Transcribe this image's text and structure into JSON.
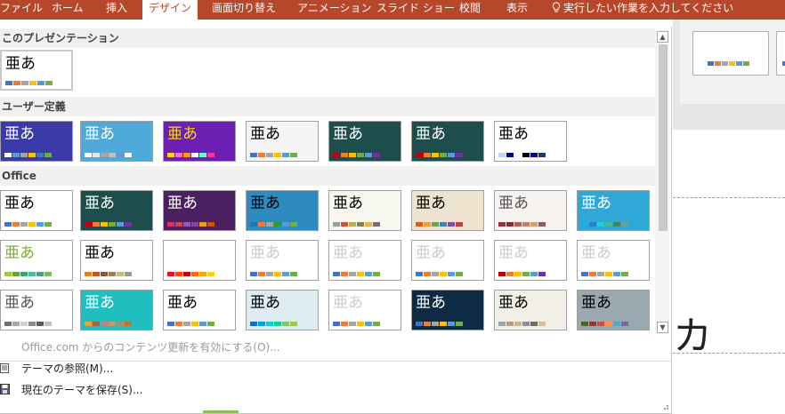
{
  "ribbon": {
    "tabs": [
      {
        "label": "ファイル",
        "active": false
      },
      {
        "label": "ホーム",
        "active": false
      },
      {
        "label": "挿入",
        "active": false
      },
      {
        "label": "デザイン",
        "active": true
      },
      {
        "label": "画面切り替え",
        "active": false
      },
      {
        "label": "アニメーション",
        "active": false
      },
      {
        "label": "スライド ショー",
        "active": false
      },
      {
        "label": "校閲",
        "active": false
      },
      {
        "label": "表示",
        "active": false
      }
    ],
    "tell_me": "実行したい作業を入力してください",
    "tell_me_icon": "lightbulb-icon",
    "accent_color": "#b7472a"
  },
  "background": {
    "slide_glyph": "カ"
  },
  "gallery": {
    "sections": [
      {
        "title": "このプレゼンテーション"
      },
      {
        "title": "ユーザー定義"
      },
      {
        "title": "Office"
      }
    ],
    "theme_sample_text": "亜あ",
    "this_presentation": [
      {
        "colors": [
          "#4472c4",
          "#ed7d31",
          "#a5a5a5",
          "#ffc000",
          "#5b9bd5",
          "#70ad47"
        ]
      }
    ],
    "custom": [
      {
        "bg": "#3a3aa8",
        "fg": "#ffffff",
        "colors": [
          "#ffffff",
          "#5b9bd5",
          "#a5a5a5",
          "#ffc000",
          "#4472c4",
          "#70ad47"
        ]
      },
      {
        "bg": "#4fa9d9",
        "fg": "#ffffff",
        "colors": [
          "#ffffff",
          "#d9e8f5",
          "#a5a5a5",
          "#bfbfbf",
          "#5b9bd5",
          "#ffffff"
        ]
      },
      {
        "bg": "#6b1fb3",
        "fg": "#ffd700",
        "colors": [
          "#ffd700",
          "#ff66cc",
          "#ff9900",
          "#ffffff",
          "#66ffcc",
          "#ff3399"
        ]
      },
      {
        "bg": "#f4f4f4",
        "fg": "#000000",
        "colors": [
          "#4472c4",
          "#ed7d31",
          "#a5a5a5",
          "#ffc000",
          "#5b9bd5",
          "#70ad47"
        ]
      },
      {
        "bg": "#1e4d4d",
        "fg": "#ffffff",
        "colors": [
          "#c00000",
          "#ed7d31",
          "#ffc000",
          "#70ad47",
          "#5b9bd5",
          "#7030a0"
        ]
      },
      {
        "bg": "#1e4d4d",
        "fg": "#ffffff",
        "colors": [
          "#c00000",
          "#ed7d31",
          "#ffc000",
          "#70ad47",
          "#5b9bd5",
          "#7030a0"
        ]
      },
      {
        "bg": "#ffffff",
        "fg": "#000000",
        "colors": [
          "#bdd7ee",
          "#000080",
          "#ffffff",
          "#000000",
          "#000080",
          "#1f3864"
        ]
      }
    ],
    "office": [
      {
        "bg": "#ffffff",
        "fg": "#000000",
        "colors": [
          "#4472c4",
          "#ed7d31",
          "#a5a5a5",
          "#ffc000",
          "#5b9bd5",
          "#70ad47"
        ]
      },
      {
        "bg": "#1e4d4d",
        "fg": "#ffffff",
        "colors": [
          "#c00000",
          "#ed7d31",
          "#ffc000",
          "#70ad47",
          "#5b9bd5",
          "#7030a0"
        ]
      },
      {
        "bg": "#4a2060",
        "fg": "#ffffff",
        "colors": [
          "#e03070",
          "#c0504d",
          "#9b59b6",
          "#8e44ad",
          "#f39c12",
          "#d35400"
        ]
      },
      {
        "bg": "#2e8bc0",
        "fg": "#000000",
        "colors": [
          "#1f78b4",
          "#ed7d31",
          "#a5a5a5",
          "#2ca02c",
          "#5b9bd5",
          "#70ad47"
        ]
      },
      {
        "bg": "#f7f7ef",
        "fg": "#000000",
        "colors": [
          "#93a299",
          "#cf543f",
          "#b5ae53",
          "#848058",
          "#e8b54d",
          "#786c71"
        ]
      },
      {
        "bg": "#ede3cf",
        "fg": "#000000",
        "colors": [
          "#d06020",
          "#f0a030",
          "#70a050",
          "#4080c0",
          "#8050a0",
          "#c04040"
        ]
      },
      {
        "bg": "#f5f2f0",
        "fg": "#555555",
        "colors": [
          "#a03040",
          "#7a3040",
          "#b06050",
          "#c08060",
          "#d0a070",
          "#806060"
        ]
      },
      {
        "bg": "#2fa8d8",
        "fg": "#ffffff",
        "colors": [
          "#1cade4",
          "#2683c6",
          "#27ced7",
          "#42ba97",
          "#3e8853",
          "#62a39f"
        ]
      },
      {
        "bg": "#ffffff",
        "fg": "#7ab030",
        "colors": [
          "#99cb38",
          "#63a537",
          "#37a76f",
          "#44c1a3",
          "#4e9a8b",
          "#7eb95a"
        ]
      },
      {
        "bg": "#ffffff",
        "fg": "#000000",
        "colors": [
          "#e48312",
          "#bd582c",
          "#865640",
          "#9b8357",
          "#c2bc80",
          "#94a088"
        ]
      },
      {
        "bg": "#ffffff",
        "fg": "#ffffff",
        "colors": [
          "#e81123",
          "#ff4500",
          "#c00000",
          "#ff6600",
          "#ffa500",
          "#ffd700"
        ]
      },
      {
        "bg": "#ffffff",
        "fg": "#cccccc",
        "colors": [
          "#4472c4",
          "#ed7d31",
          "#a5a5a5",
          "#ffc000",
          "#5b9bd5",
          "#70ad47"
        ]
      },
      {
        "bg": "#ffffff",
        "fg": "#cccccc",
        "colors": [
          "#4472c4",
          "#ed7d31",
          "#a5a5a5",
          "#ffc000",
          "#5b9bd5",
          "#70ad47"
        ]
      },
      {
        "bg": "#ffffff",
        "fg": "#cccccc",
        "colors": [
          "#4472c4",
          "#ed7d31",
          "#a5a5a5",
          "#ffc000",
          "#5b9bd5",
          "#70ad47"
        ]
      },
      {
        "bg": "#ffffff",
        "fg": "#cccccc",
        "colors": [
          "#c00000",
          "#ed7d31",
          "#ffc000",
          "#70ad47",
          "#5b9bd5",
          "#7030a0"
        ]
      },
      {
        "bg": "#ffffff",
        "fg": "#cccccc",
        "colors": [
          "#4472c4",
          "#ed7d31",
          "#a5a5a5",
          "#ffc000",
          "#5b9bd5",
          "#70ad47"
        ]
      },
      {
        "bg": "#ffffff",
        "fg": "#555555",
        "colors": [
          "#6f6f74",
          "#a8a8a8",
          "#cfcfcf",
          "#8b8b8b",
          "#5a5a5a",
          "#c0c0c0"
        ]
      },
      {
        "bg": "#1fbfbf",
        "fg": "#ffffff",
        "colors": [
          "#f0a22e",
          "#a5644e",
          "#b58b80",
          "#c3986d",
          "#a19574",
          "#c17529"
        ]
      },
      {
        "bg": "#ffffff",
        "fg": "#000000",
        "colors": [
          "#4472c4",
          "#ed7d31",
          "#a5a5a5",
          "#ffc000",
          "#5b9bd5",
          "#70ad47"
        ]
      },
      {
        "bg": "#dcecf0",
        "fg": "#000000",
        "colors": [
          "#0f6fc6",
          "#009dd9",
          "#0bd0d9",
          "#10cf9b",
          "#7cca62",
          "#a5c249"
        ]
      },
      {
        "bg": "#ffffff",
        "fg": "#cccccc",
        "colors": [
          "#4472c4",
          "#ed7d31",
          "#a5a5a5",
          "#ffc000",
          "#5b9bd5",
          "#70ad47"
        ]
      },
      {
        "bg": "#0f2a44",
        "fg": "#ffffff",
        "colors": [
          "#4472c4",
          "#ed7d31",
          "#a5a5a5",
          "#ffc000",
          "#5b9bd5",
          "#70ad47"
        ]
      },
      {
        "bg": "#f2efe6",
        "fg": "#000000",
        "colors": [
          "#a5a5a5",
          "#b0a080",
          "#c8b890",
          "#909090",
          "#6d6d6d",
          "#d0c0a0"
        ]
      },
      {
        "bg": "#9aa8b0",
        "fg": "#000000",
        "colors": [
          "#4f6228",
          "#953735",
          "#c0504d",
          "#f79646",
          "#4bacc6",
          "#8064a2"
        ]
      }
    ]
  },
  "menu": {
    "items": [
      {
        "label": "Office.com からのコンテンツ更新を有効にする(O)...",
        "enabled": false
      },
      {
        "label": "テーマの参照(M)...",
        "enabled": true,
        "icon": "browse-themes-icon"
      },
      {
        "label": "現在のテーマを保存(S)...",
        "enabled": true,
        "icon": "save-theme-icon"
      }
    ]
  }
}
